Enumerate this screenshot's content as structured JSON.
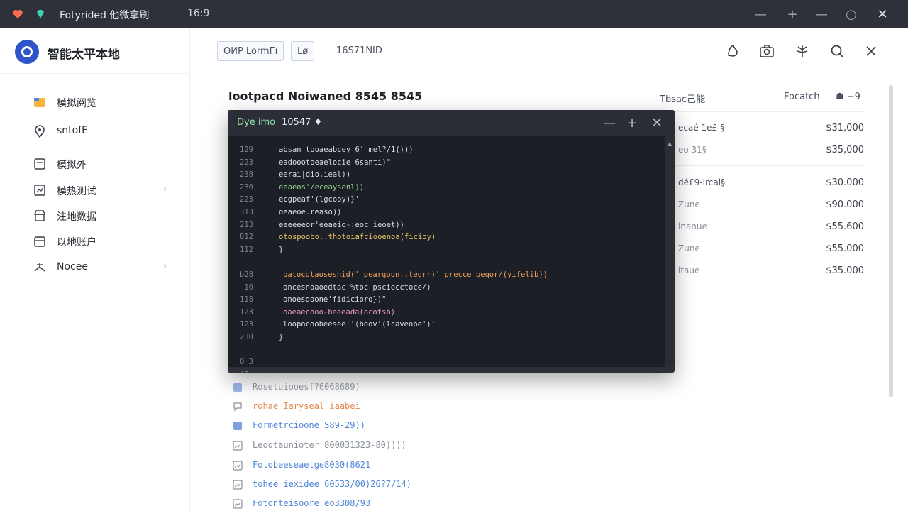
{
  "window": {
    "title": "Fotyrided  他微拿刷",
    "ratio": "16:9"
  },
  "sidebar": {
    "app_name": "智能太平本地",
    "items": [
      {
        "label": "模拟阅览",
        "icon": "folder-icon",
        "has_chevron": false
      },
      {
        "label": "sntofE",
        "icon": "location-pin-icon",
        "has_chevron": false
      },
      {
        "label": "模拟外",
        "icon": "document-icon",
        "has_chevron": false
      },
      {
        "label": "模热测试",
        "icon": "chart-icon",
        "has_chevron": true
      },
      {
        "label": "注地数据",
        "icon": "store-icon",
        "has_chevron": false
      },
      {
        "label": "以地账户",
        "icon": "card-icon",
        "has_chevron": false
      },
      {
        "label": "Nocee",
        "icon": "antenna-icon",
        "has_chevron": true
      }
    ]
  },
  "header": {
    "tabs": [
      "ΘИР   LormГı",
      "Lø"
    ],
    "id": "16S71NID",
    "icons": [
      "shield-icon",
      "camera-icon",
      "plant-icon",
      "search-icon",
      "close-icon"
    ]
  },
  "content": {
    "title": "lootpacd Noiwaned 8545 8545",
    "columns": [
      "Tbsac己能",
      "Focatch",
      "☗ −9"
    ],
    "rows": [
      {
        "label": "ecaé 1e£-§",
        "value": "$31,000"
      },
      {
        "label": "eo 31§",
        "value": "$35,000"
      },
      {
        "label": "dé£9-Ircal§",
        "value": "$30.000"
      },
      {
        "label": "Zune",
        "value": "$90.000"
      },
      {
        "label": "inanue",
        "value": "$55.600"
      },
      {
        "label": "Zune",
        "value": "$55.000"
      },
      {
        "label": "itaue",
        "value": "$35.000"
      }
    ],
    "list": [
      {
        "text": "Rosetuiooesf?6068689)",
        "color": "#9aa0ab",
        "icon": "document-blue-icon"
      },
      {
        "text": "rohae Iaryseal iaabei",
        "color": "#e58a4c",
        "icon": "chat-icon"
      },
      {
        "text": "Formetrcioone S89-29))",
        "color": "#4f86d8",
        "icon": "document-blue-icon"
      },
      {
        "text": "Leootaunioter 800031323-80))))",
        "color": "#8a909a",
        "icon": "image-icon"
      },
      {
        "text": "Fotobeeseaetge8030(8621",
        "color": "#4f86d8",
        "icon": "image-icon"
      },
      {
        "text": "tohee iexidee 60533/00)26?7/14)",
        "color": "#4f86d8",
        "icon": "image-icon"
      },
      {
        "text": "Fotonteisoore eo3308/93",
        "color": "#4f86d8",
        "icon": "image-icon"
      }
    ]
  },
  "code_window": {
    "title": "Dye imo",
    "tab": "10547 ♦",
    "lines": [
      {
        "num": "129",
        "indent": 1,
        "text": "absan tooaeabcey 6' mel?/1()))",
        "cls": "c-def"
      },
      {
        "num": "223",
        "indent": 1,
        "text": "eadoootoeaelocie 6santi)\"",
        "cls": "c-def"
      },
      {
        "num": "238",
        "indent": 1,
        "text": "eerai|dio.ieal))",
        "cls": "c-def"
      },
      {
        "num": "230",
        "indent": 1,
        "text": "eeaeos'/eceaysenl))",
        "cls": "c-green"
      },
      {
        "num": "223",
        "indent": 1,
        "text": "ecgpeaf'(lgcooy)}'",
        "cls": "c-def"
      },
      {
        "num": "313",
        "indent": 1,
        "text": "oeaeoe.reaso))",
        "cls": "c-def"
      },
      {
        "num": "213",
        "indent": 1,
        "text": "eeeeeeor'eeaeio-:eoc ieoet))",
        "cls": "c-def"
      },
      {
        "num": "812",
        "indent": 1,
        "text": "otospoobo..thotoiafciooenoa(ficioy)",
        "cls": "c-yellow"
      },
      {
        "num": "112",
        "indent": 0,
        "text": "}",
        "cls": "c-def"
      },
      {
        "num": "",
        "indent": 0,
        "text": "",
        "cls": "c-def"
      },
      {
        "num": "b28",
        "indent": 2,
        "text": "patocdtaosesnid(' peargoon..tegrr)' precce beqor/(yifelib))",
        "cls": "c-orange"
      },
      {
        "num": "10",
        "indent": 2,
        "text": "oncesnoaoedtac'%toc psciocctoce/)",
        "cls": "c-def"
      },
      {
        "num": "118",
        "indent": 2,
        "text": "onoesdoone'fidicioro})\"",
        "cls": "c-def"
      },
      {
        "num": "123",
        "indent": 2,
        "text": "oaeaecooo-beeeada(ocotsb)",
        "cls": "c-pink"
      },
      {
        "num": "123",
        "indent": 2,
        "text": "loopocoobeesee''(boov'(lcaveooe')'",
        "cls": "c-def"
      },
      {
        "num": "230",
        "indent": 1,
        "text": "}",
        "cls": "c-def"
      },
      {
        "num": "",
        "indent": 0,
        "text": "",
        "cls": "c-def"
      },
      {
        "num": "0 3",
        "indent": 0,
        "text": "",
        "cls": "c-def"
      },
      {
        "num": "(? ",
        "indent": 0,
        "text": "",
        "cls": "c-def"
      }
    ]
  },
  "colors": {
    "titlebar": "#2e313a",
    "accent": "#2f54c9",
    "code_bg": "#1c1f25"
  }
}
